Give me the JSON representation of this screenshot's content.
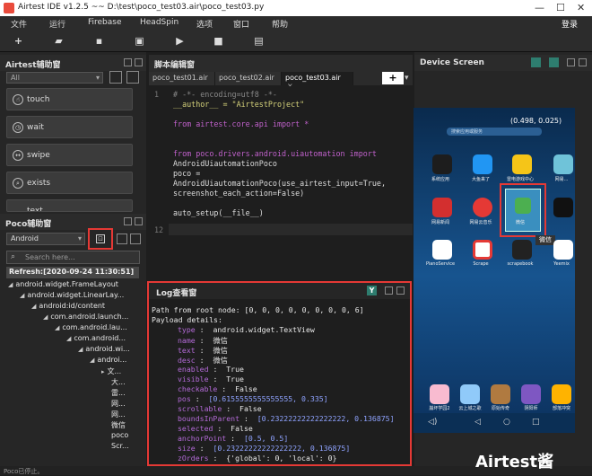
{
  "window": {
    "title": "Airtest IDE v1.2.5 ~~ D:\\test\\poco_test03.air\\poco_test03.py",
    "minimize": "—",
    "maximize": "☐",
    "close": "✕",
    "login": "登录"
  },
  "menu": [
    "文件",
    "运行",
    "Firebase",
    "HeadSpin",
    "选项",
    "窗口",
    "帮助"
  ],
  "airtest_panel": {
    "title": "Airtest辅助窗",
    "select_value": "All",
    "commands": [
      "touch",
      "wait",
      "swipe",
      "exists",
      "text"
    ]
  },
  "poco_panel": {
    "title": "Poco辅助窗",
    "mode_value": "Android",
    "search_placeholder": "Search here...",
    "refresh_text": "Refresh:[2020-09-24 11:30:51]",
    "tree": [
      "android.widget.FrameLayout",
      "android.widget.LinearLay...",
      "android:id/content",
      "com.android.launch...",
      "com.android.lau...",
      "com.android...",
      "android.wi...",
      "androi...",
      "文...",
      "大...",
      "雷...",
      "网...",
      "网...",
      "微信",
      "poco",
      "Scr..."
    ]
  },
  "editor": {
    "title": "脚本编辑窗",
    "tabs": [
      "poco_test01.air",
      "poco_test02.air",
      "poco_test03.air"
    ],
    "lines": [
      {
        "n": "1",
        "text": "# -*- encoding=utf8 -*-"
      },
      {
        "n": "",
        "text": "__author__ = \"AirtestProject\""
      },
      {
        "n": "",
        "text": ""
      },
      {
        "n": "",
        "text": "from airtest.core.api import *"
      },
      {
        "n": "",
        "text": ""
      },
      {
        "n": "",
        "text": ""
      },
      {
        "n": "",
        "text": "from poco.drivers.android.uiautomation import"
      },
      {
        "n": "",
        "text": "AndroidUiautomationPoco"
      },
      {
        "n": "",
        "text": "poco ="
      },
      {
        "n": "",
        "text": "AndroidUiautomationPoco(use_airtest_input=True,"
      },
      {
        "n": "",
        "text": "screenshot_each_action=False)"
      },
      {
        "n": "",
        "text": ""
      },
      {
        "n": "",
        "text": "auto_setup(__file__)"
      },
      {
        "n": "12",
        "text": ""
      }
    ]
  },
  "log": {
    "title": "Log查看窗",
    "path": "Path from root node: [0, 0, 0, 0, 0, 0, 0, 0, 6]",
    "payload": "Payload details:",
    "props": [
      {
        "k": "type",
        "v": "android.widget.TextView"
      },
      {
        "k": "name",
        "v": "微信"
      },
      {
        "k": "text",
        "v": "微信"
      },
      {
        "k": "desc",
        "v": "微信"
      },
      {
        "k": "enabled",
        "v": "True"
      },
      {
        "k": "visible",
        "v": "True"
      },
      {
        "k": "checkable",
        "v": "False"
      },
      {
        "k": "pos",
        "v": "[0.6155555555555555, 0.335]"
      },
      {
        "k": "scrollable",
        "v": "False"
      },
      {
        "k": "boundsInParent",
        "v": "[0.23222222222222222, 0.136875]"
      },
      {
        "k": "selected",
        "v": "False"
      },
      {
        "k": "anchorPoint",
        "v": "[0.5, 0.5]"
      },
      {
        "k": "size",
        "v": "[0.23222222222222222, 0.136875]"
      },
      {
        "k": "zOrders",
        "v": "{'global': 0, 'local': 0}"
      }
    ]
  },
  "device": {
    "title": "Device Screen",
    "coords": "(0.498, 0.025)",
    "search_hint": "搜索应用或服务",
    "apps_row1": [
      "系统应用",
      "大鱼来了",
      "雷电游戏中心",
      "网易..."
    ],
    "apps_row2": [
      "网易新闻",
      "网易云音乐",
      "微信",
      ""
    ],
    "apps_row3": [
      "PianoService",
      "Scrape",
      "scrapebook",
      "Yeemix"
    ],
    "apps_bottom": [
      "崩坏学园2",
      "云上城之歌",
      "原始传奇",
      "阴阳师",
      "部落冲突"
    ],
    "tooltip": "微信"
  },
  "status": "Poco已停止。",
  "watermark": "Airtest酱",
  "colors": {
    "accent_red": "#e53935",
    "keyword": "#c061cb",
    "string": "#d4d17a",
    "prop_key": "#b36ad7"
  }
}
